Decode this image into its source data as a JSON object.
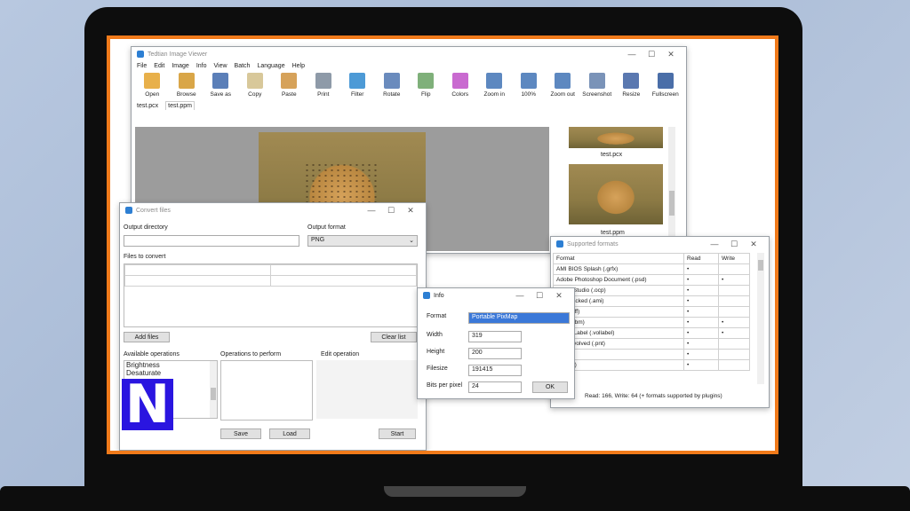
{
  "viewer": {
    "title": "Tedtian Image Viewer",
    "menu": [
      "File",
      "Edit",
      "Image",
      "Info",
      "View",
      "Batch",
      "Language",
      "Help"
    ],
    "tools": [
      {
        "label": "Open",
        "icon": "folder-icon",
        "color": "#e8b04a"
      },
      {
        "label": "Browse",
        "icon": "browse-icon",
        "color": "#d9a648"
      },
      {
        "label": "Save as",
        "icon": "save-icon",
        "color": "#5b7fb8"
      },
      {
        "label": "Copy",
        "icon": "copy-icon",
        "color": "#d8c89a"
      },
      {
        "label": "Paste",
        "icon": "paste-icon",
        "color": "#d6a25a"
      },
      {
        "label": "Print",
        "icon": "print-icon",
        "color": "#8e9aa8"
      },
      {
        "label": "Filter",
        "icon": "droplet-icon",
        "color": "#4d9ad6"
      },
      {
        "label": "Rotate",
        "icon": "rotate-icon",
        "color": "#6a8bbd"
      },
      {
        "label": "Flip",
        "icon": "flip-icon",
        "color": "#7fb07a"
      },
      {
        "label": "Colors",
        "icon": "color-wheel-icon",
        "color": "#c96ad0"
      },
      {
        "label": "Zoom in",
        "icon": "zoom-in-icon",
        "color": "#5d88c0"
      },
      {
        "label": "100%",
        "icon": "zoom-100-icon",
        "color": "#5d88c0"
      },
      {
        "label": "Zoom out",
        "icon": "zoom-out-icon",
        "color": "#5d88c0"
      },
      {
        "label": "Screenshot",
        "icon": "camera-icon",
        "color": "#7a93b8"
      },
      {
        "label": "Resize",
        "icon": "resize-icon",
        "color": "#5a78b0"
      },
      {
        "label": "Fullscreen",
        "icon": "monitor-icon",
        "color": "#4a6ea8"
      }
    ],
    "tabs": [
      "test.pcx",
      "test.ppm"
    ],
    "thumbnails": [
      "test.pcx",
      "test.ppm"
    ]
  },
  "convert": {
    "title": "Convert files",
    "output_directory_label": "Output directory",
    "output_directory_value": "",
    "output_format_label": "Output format",
    "output_format_value": "PNG",
    "files_label": "Files to convert",
    "add_files": "Add files",
    "clear_list": "Clear list",
    "available_ops_label": "Available operations",
    "available_ops": [
      "Brightness",
      "Desaturate"
    ],
    "ops_to_perform_label": "Operations to perform",
    "edit_op_label": "Edit operation",
    "save": "Save",
    "load": "Load",
    "start": "Start",
    "badge_letter": "N",
    "badge_color": "#2a15e0"
  },
  "info": {
    "title": "Info",
    "fields": [
      {
        "label": "Format",
        "value": "Portable PixMap"
      },
      {
        "label": "Width",
        "value": "319"
      },
      {
        "label": "Height",
        "value": "200"
      },
      {
        "label": "Filesize",
        "value": "191415"
      },
      {
        "label": "Bits per pixel",
        "value": "24"
      }
    ],
    "ok": "OK"
  },
  "formats": {
    "title": "Supported formats",
    "headers": [
      "Format",
      "Read",
      "Write"
    ],
    "rows": [
      {
        "name": "AMI BIOS Splash (.grfx)",
        "read": "•",
        "write": ""
      },
      {
        "name": "Adobe Photoshop Document (.psd)",
        "read": "•",
        "write": "•"
      },
      {
        "name": "ed Art Studio (.ocp)",
        "read": "•",
        "write": ""
      },
      {
        "name": "aint, packed (.ami)",
        "read": "•",
        "write": ""
      },
      {
        "name": "LBM (.iff)",
        "read": "•",
        "write": ""
      },
      {
        "name": "LBM (.lbm)",
        "read": "•",
        "write": "•"
      },
      {
        "name": "olume Label (.vollabel)",
        "read": "•",
        "write": "•"
      },
      {
        "name": "vival Evolved (.pnt)",
        "read": "•",
        "write": ""
      },
      {
        "name": "(.a64)",
        "read": "•",
        "write": ""
      },
      {
        "name": "B (.4mi)",
        "read": "•",
        "write": ""
      }
    ],
    "status": "Read: 166, Write: 64 (+ formats supported by plugins)"
  }
}
